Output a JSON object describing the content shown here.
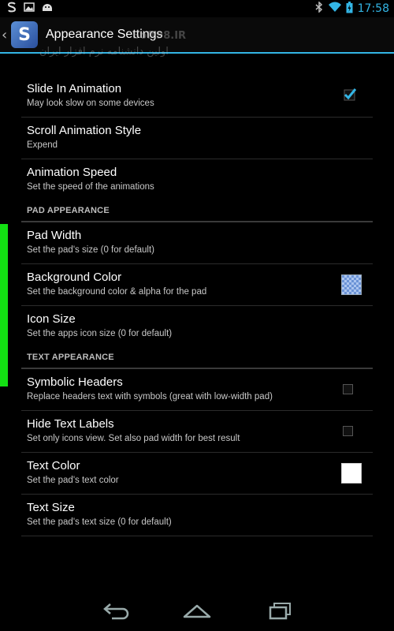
{
  "status_bar": {
    "time": "17:58",
    "left_icons": [
      "app-s-icon",
      "image-icon",
      "android-icon"
    ],
    "right_icons": [
      "bluetooth-icon",
      "wifi-icon",
      "battery-icon"
    ]
  },
  "action_bar": {
    "title": "Appearance Settings",
    "watermark_text": "اولین دانشنامه نرم افزار ایران",
    "watermark_logo": "Soft98.IR"
  },
  "colors": {
    "accent": "#33b5e5",
    "edge_indicator": "#13e013",
    "background": "#000000"
  },
  "items": {
    "slide_in": {
      "title": "Slide In Animation",
      "summary": "May look slow on some devices",
      "checked": true
    },
    "scroll_style": {
      "title": "Scroll Animation Style",
      "summary": "Expend"
    },
    "anim_speed": {
      "title": "Animation Speed",
      "summary": "Set the speed of the animations"
    },
    "pad_width": {
      "title": "Pad Width",
      "summary": "Set the pad's size (0 for default)"
    },
    "bg_color": {
      "title": "Background Color",
      "summary": "Set the background color & alpha for the pad"
    },
    "icon_size": {
      "title": "Icon Size",
      "summary": "Set the apps icon size (0 for default)"
    },
    "symbolic_headers": {
      "title": "Symbolic Headers",
      "summary": "Replace headers text with symbols (great with low-width pad)",
      "checked": false
    },
    "hide_labels": {
      "title": "Hide Text Labels",
      "summary": "Set only icons view. Set also pad width for best result",
      "checked": false
    },
    "text_color": {
      "title": "Text Color",
      "summary": "Set the pad's text color"
    },
    "text_size": {
      "title": "Text Size",
      "summary": "Set the pad's text size (0 for default)"
    }
  },
  "sections": {
    "pad": "PAD APPEARANCE",
    "text": "TEXT APPEARANCE"
  },
  "nav_bar": {
    "icons": [
      "back-icon",
      "home-icon",
      "recent-apps-icon"
    ]
  }
}
